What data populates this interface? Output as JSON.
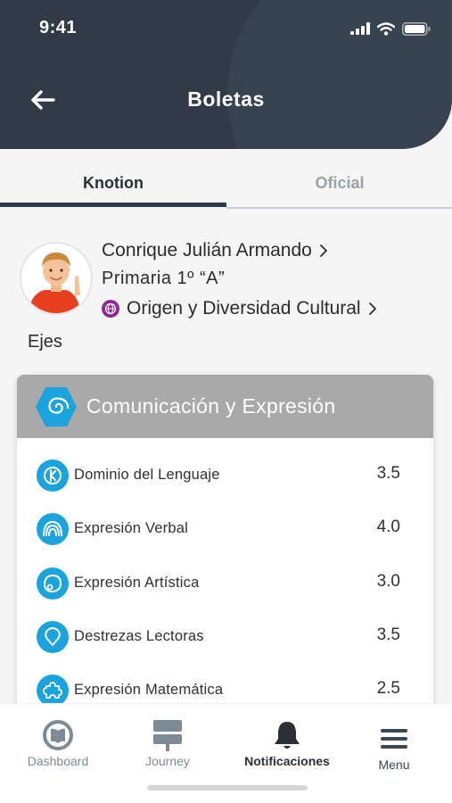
{
  "status_bar": {
    "time": "9:41"
  },
  "header": {
    "title": "Boletas"
  },
  "tabs": [
    {
      "label": "Knotion",
      "active": true
    },
    {
      "label": "Oficial",
      "active": false
    }
  ],
  "student": {
    "name": "Conrique Julián Armando",
    "grade": "Primaria  1º  “A”",
    "program": "Origen y Diversidad Cultural",
    "program_color": "#8b2a8f"
  },
  "section_label": "Ejes",
  "card": {
    "title": "Comunicación y Expresión",
    "header_color": "#a9a9a9",
    "accent_color": "#1aa3dc",
    "rows": [
      {
        "icon": "k-circle-icon",
        "label": "Dominio del Lenguaje",
        "score": "3.5"
      },
      {
        "icon": "sound-waves-icon",
        "label": "Expresión Verbal",
        "score": "4.0"
      },
      {
        "icon": "palette-icon",
        "label": "Expresión Artística",
        "score": "3.0"
      },
      {
        "icon": "location-pin-icon",
        "label": "Destrezas Lectoras",
        "score": "3.5"
      },
      {
        "icon": "puzzle-icon",
        "label": "Expresión Matemática",
        "score": "2.5"
      }
    ]
  },
  "bottom_nav": {
    "items": [
      {
        "label": "Dashboard",
        "icon": "book-circle-icon",
        "active": false
      },
      {
        "label": "Journey",
        "icon": "signpost-icon",
        "active": false
      },
      {
        "label": "Notificaciones",
        "icon": "bell-icon",
        "active": true
      },
      {
        "label": "Menu",
        "icon": "hamburger-icon",
        "active": false
      }
    ]
  }
}
